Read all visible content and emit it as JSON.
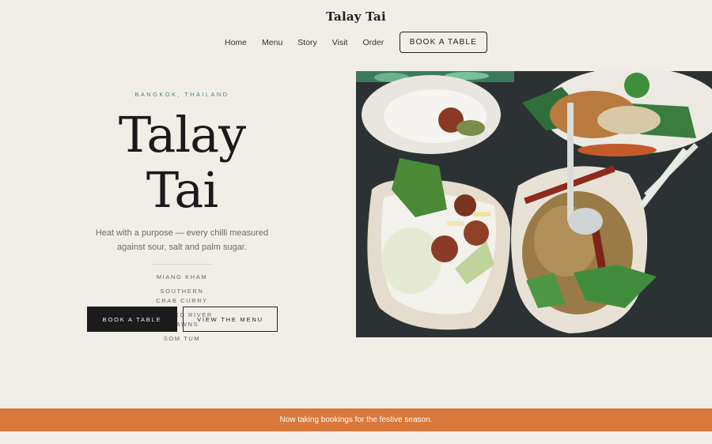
{
  "header": {
    "brand": "Talay Tai",
    "nav": [
      "Home",
      "Menu",
      "Story",
      "Visit",
      "Order"
    ],
    "cta": "BOOK A TABLE"
  },
  "hero": {
    "eyebrow": "BANGKOK, THAILAND",
    "title": "Talay Tai",
    "tagline": "Heat with a purpose — every chilli measured against sour, salt and palm sugar.",
    "dishes": [
      "MIANG KHAM",
      "SOUTHERN CRAB CURRY",
      "GRILLED RIVER PRAWNS",
      "SOM TUM"
    ],
    "primary_button": "BOOK A TABLE",
    "secondary_button": "VIEW THE MENU"
  },
  "banner": {
    "text": "Now taking bookings for the festive season."
  },
  "colors": {
    "background": "#f1eee7",
    "accent_banner": "#d9783b",
    "eyebrow_green": "#4a8a5a",
    "primary_button": "#1b1b1b"
  }
}
